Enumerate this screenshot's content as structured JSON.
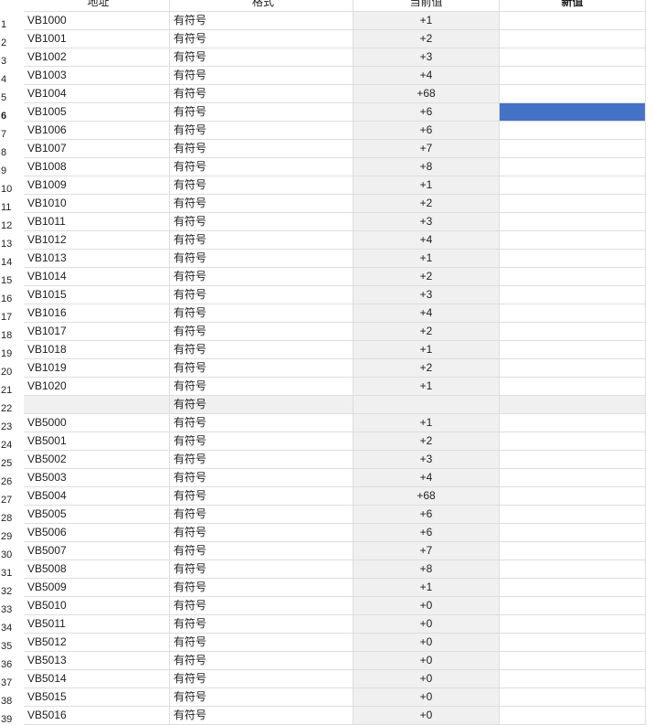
{
  "table": {
    "headers": {
      "address": "地址",
      "format": "格式",
      "current": "当前值",
      "new": "新值"
    },
    "selected_row": 6,
    "rows": [
      {
        "n": "1",
        "address": "VB1000",
        "format": "有符号",
        "current": "+1",
        "new": ""
      },
      {
        "n": "2",
        "address": "VB1001",
        "format": "有符号",
        "current": "+2",
        "new": ""
      },
      {
        "n": "3",
        "address": "VB1002",
        "format": "有符号",
        "current": "+3",
        "new": ""
      },
      {
        "n": "4",
        "address": "VB1003",
        "format": "有符号",
        "current": "+4",
        "new": ""
      },
      {
        "n": "5",
        "address": "VB1004",
        "format": "有符号",
        "current": "+68",
        "new": ""
      },
      {
        "n": "6",
        "address": "VB1005",
        "format": "有符号",
        "current": "+6",
        "new": ""
      },
      {
        "n": "7",
        "address": "VB1006",
        "format": "有符号",
        "current": "+6",
        "new": ""
      },
      {
        "n": "8",
        "address": "VB1007",
        "format": "有符号",
        "current": "+7",
        "new": ""
      },
      {
        "n": "9",
        "address": "VB1008",
        "format": "有符号",
        "current": "+8",
        "new": ""
      },
      {
        "n": "10",
        "address": "VB1009",
        "format": "有符号",
        "current": "+1",
        "new": ""
      },
      {
        "n": "11",
        "address": "VB1010",
        "format": "有符号",
        "current": "+2",
        "new": ""
      },
      {
        "n": "12",
        "address": "VB1011",
        "format": "有符号",
        "current": "+3",
        "new": ""
      },
      {
        "n": "13",
        "address": "VB1012",
        "format": "有符号",
        "current": "+4",
        "new": ""
      },
      {
        "n": "14",
        "address": "VB1013",
        "format": "有符号",
        "current": "+1",
        "new": ""
      },
      {
        "n": "15",
        "address": "VB1014",
        "format": "有符号",
        "current": "+2",
        "new": ""
      },
      {
        "n": "16",
        "address": "VB1015",
        "format": "有符号",
        "current": "+3",
        "new": ""
      },
      {
        "n": "17",
        "address": "VB1016",
        "format": "有符号",
        "current": "+4",
        "new": ""
      },
      {
        "n": "18",
        "address": "VB1017",
        "format": "有符号",
        "current": "+2",
        "new": ""
      },
      {
        "n": "19",
        "address": "VB1018",
        "format": "有符号",
        "current": "+1",
        "new": ""
      },
      {
        "n": "20",
        "address": "VB1019",
        "format": "有符号",
        "current": "+2",
        "new": ""
      },
      {
        "n": "21",
        "address": "VB1020",
        "format": "有符号",
        "current": "+1",
        "new": ""
      },
      {
        "n": "22",
        "address": "",
        "format": "有符号",
        "current": "",
        "new": ""
      },
      {
        "n": "23",
        "address": "VB5000",
        "format": "有符号",
        "current": "+1",
        "new": ""
      },
      {
        "n": "24",
        "address": "VB5001",
        "format": "有符号",
        "current": "+2",
        "new": ""
      },
      {
        "n": "25",
        "address": "VB5002",
        "format": "有符号",
        "current": "+3",
        "new": ""
      },
      {
        "n": "26",
        "address": "VB5003",
        "format": "有符号",
        "current": "+4",
        "new": ""
      },
      {
        "n": "27",
        "address": "VB5004",
        "format": "有符号",
        "current": "+68",
        "new": ""
      },
      {
        "n": "28",
        "address": "VB5005",
        "format": "有符号",
        "current": "+6",
        "new": ""
      },
      {
        "n": "29",
        "address": "VB5006",
        "format": "有符号",
        "current": "+6",
        "new": ""
      },
      {
        "n": "30",
        "address": "VB5007",
        "format": "有符号",
        "current": "+7",
        "new": ""
      },
      {
        "n": "31",
        "address": "VB5008",
        "format": "有符号",
        "current": "+8",
        "new": ""
      },
      {
        "n": "32",
        "address": "VB5009",
        "format": "有符号",
        "current": "+1",
        "new": ""
      },
      {
        "n": "33",
        "address": "VB5010",
        "format": "有符号",
        "current": "+0",
        "new": ""
      },
      {
        "n": "34",
        "address": "VB5011",
        "format": "有符号",
        "current": "+0",
        "new": ""
      },
      {
        "n": "35",
        "address": "VB5012",
        "format": "有符号",
        "current": "+0",
        "new": ""
      },
      {
        "n": "36",
        "address": "VB5013",
        "format": "有符号",
        "current": "+0",
        "new": ""
      },
      {
        "n": "37",
        "address": "VB5014",
        "format": "有符号",
        "current": "+0",
        "new": ""
      },
      {
        "n": "38",
        "address": "VB5015",
        "format": "有符号",
        "current": "+0",
        "new": ""
      },
      {
        "n": "39",
        "address": "VB5016",
        "format": "有符号",
        "current": "+0",
        "new": ""
      }
    ]
  }
}
